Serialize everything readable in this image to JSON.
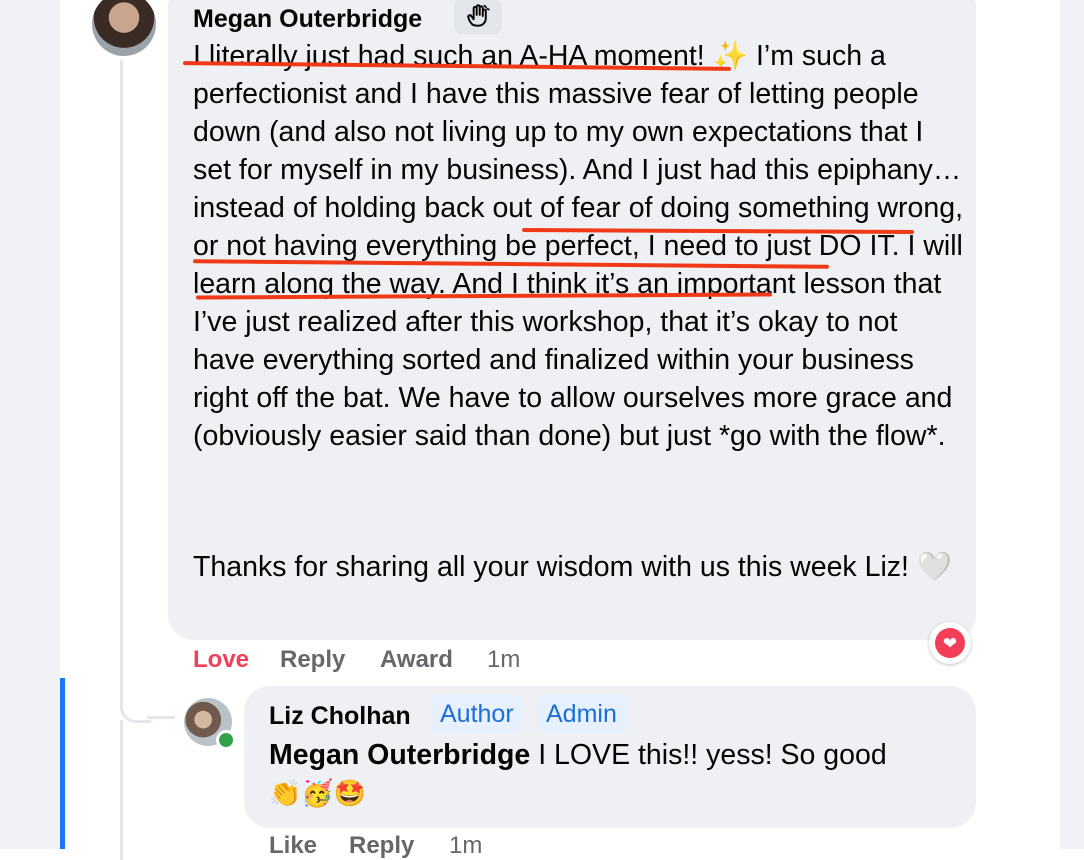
{
  "colors": {
    "accent": "#1877f2",
    "love": "#f33e58",
    "underline": "#f03a17",
    "bubble": "#eef0f3",
    "badge_text": "#1a6ed8"
  },
  "main_comment": {
    "author": "Megan Outerbridge",
    "author_badge_icon": "waving-hand-icon",
    "paragraph1": "I literally just had such an A-HA moment! ✨ I’m such a perfectionist and I have this massive fear of letting people down (and also not living up to my own expectations that I set for myself in my business). And I just had this epiphany… instead of holding back out of fear of doing something wrong, or not having everything be perfect, I need to just DO IT. I will learn along the way. And I think it’s an important lesson that I’ve just realized after this workshop, that it’s okay to not have everything sorted and finalized within your business right off the bat. We have to allow ourselves more grace and (obviously easier said than done) but just *go with the flow*.",
    "paragraph2": "Thanks for sharing all your wisdom with us this week Liz! 🤍",
    "reaction_icon": "heart-icon",
    "actions": {
      "love": "Love",
      "reply": "Reply",
      "award": "Award",
      "time": "1m"
    }
  },
  "reply_comment": {
    "author": "Liz Cholhan",
    "badges": [
      "Author",
      "Admin"
    ],
    "mention": "Megan Outerbridge",
    "text": " I LOVE this!! yess! So good",
    "emojis": "👏🥳🤩",
    "actions": {
      "like": "Like",
      "reply": "Reply",
      "time": "1m"
    }
  }
}
